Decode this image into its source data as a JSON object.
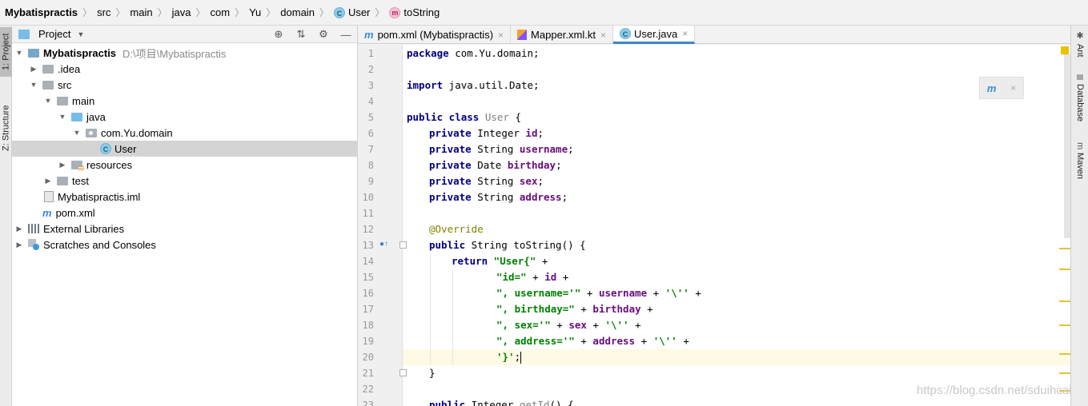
{
  "breadcrumb": [
    "Mybatispractis",
    "src",
    "main",
    "java",
    "com",
    "Yu",
    "domain",
    "User",
    "toString"
  ],
  "left_strip": {
    "project_tab": "1: Project",
    "structure_tab": "Z: Structure"
  },
  "project_panel": {
    "title": "Project",
    "tree": [
      {
        "label": "Mybatispractis",
        "path": "D:\\项目\\Mybatispractis"
      },
      {
        "label": ".idea"
      },
      {
        "label": "src"
      },
      {
        "label": "main"
      },
      {
        "label": "java"
      },
      {
        "label": "com.Yu.domain"
      },
      {
        "label": "User"
      },
      {
        "label": "resources"
      },
      {
        "label": "test"
      },
      {
        "label": "Mybatispractis.iml"
      },
      {
        "label": "pom.xml"
      },
      {
        "label": "External Libraries"
      },
      {
        "label": "Scratches and Consoles"
      }
    ]
  },
  "editor_tabs": [
    {
      "label": "pom.xml (Mybatispractis)",
      "close": "×"
    },
    {
      "label": "Mapper.xml.kt",
      "close": "×"
    },
    {
      "label": "User.java",
      "close": "×"
    }
  ],
  "editor": {
    "line_numbers": [
      "1",
      "2",
      "3",
      "4",
      "5",
      "6",
      "7",
      "8",
      "9",
      "10",
      "11",
      "12",
      "13",
      "14",
      "15",
      "16",
      "17",
      "18",
      "19",
      "20",
      "21",
      "22",
      "23"
    ],
    "code": {
      "l1": {
        "kw": "package",
        "rest": " com.Yu.domain;"
      },
      "l3": {
        "kw": "import",
        "rest": " java.util.Date;"
      },
      "l5": {
        "kw1": "public",
        "kw2": " class",
        "name": " User",
        "rest": " {"
      },
      "fields": [
        {
          "kw": "private",
          "type": " Integer ",
          "name": "id",
          "end": ";"
        },
        {
          "kw": "private",
          "type": " String ",
          "name": "username",
          "end": ";"
        },
        {
          "kw": "private",
          "type": " Date ",
          "name": "birthday",
          "end": ";"
        },
        {
          "kw": "private",
          "type": " String ",
          "name": "sex",
          "end": ";"
        },
        {
          "kw": "private",
          "type": " String ",
          "name": "address",
          "end": ";"
        }
      ],
      "l12": "@Override",
      "l13": {
        "kw": "public",
        "rest": " String toString() {"
      },
      "l14": {
        "kw": "return",
        "str": " \"User{\"",
        "rest": " +"
      },
      "l15": {
        "str": "\"id=\"",
        "mid": " + ",
        "field": "id",
        "rest": " +"
      },
      "l16": {
        "str": "\", username='\"",
        "mid": " + ",
        "field": "username",
        "mid2": " + ",
        "str2": "'\\''",
        "rest": " +"
      },
      "l17": {
        "str": "\", birthday=\"",
        "mid": " + ",
        "field": "birthday",
        "rest": " +"
      },
      "l18": {
        "str": "\", sex='\"",
        "mid": " + ",
        "field": "sex",
        "mid2": " + ",
        "str2": "'\\''",
        "rest": " +"
      },
      "l19": {
        "str": "\", address='\"",
        "mid": " + ",
        "field": "address",
        "mid2": " + ",
        "str2": "'\\''",
        "rest": " +"
      },
      "l20": {
        "str": "'}'",
        "rest": ";"
      },
      "l21": "}",
      "l23": {
        "kw": "public",
        "rest": " Integer ",
        "method": "getId",
        "end": "() {"
      }
    },
    "maven_popup": {
      "logo": "m",
      "close": "×"
    }
  },
  "right_strip": {
    "ant": "Ant",
    "database": "Database",
    "maven": "Maven"
  },
  "watermark": "https://blog.csdn.net/sduihcai"
}
